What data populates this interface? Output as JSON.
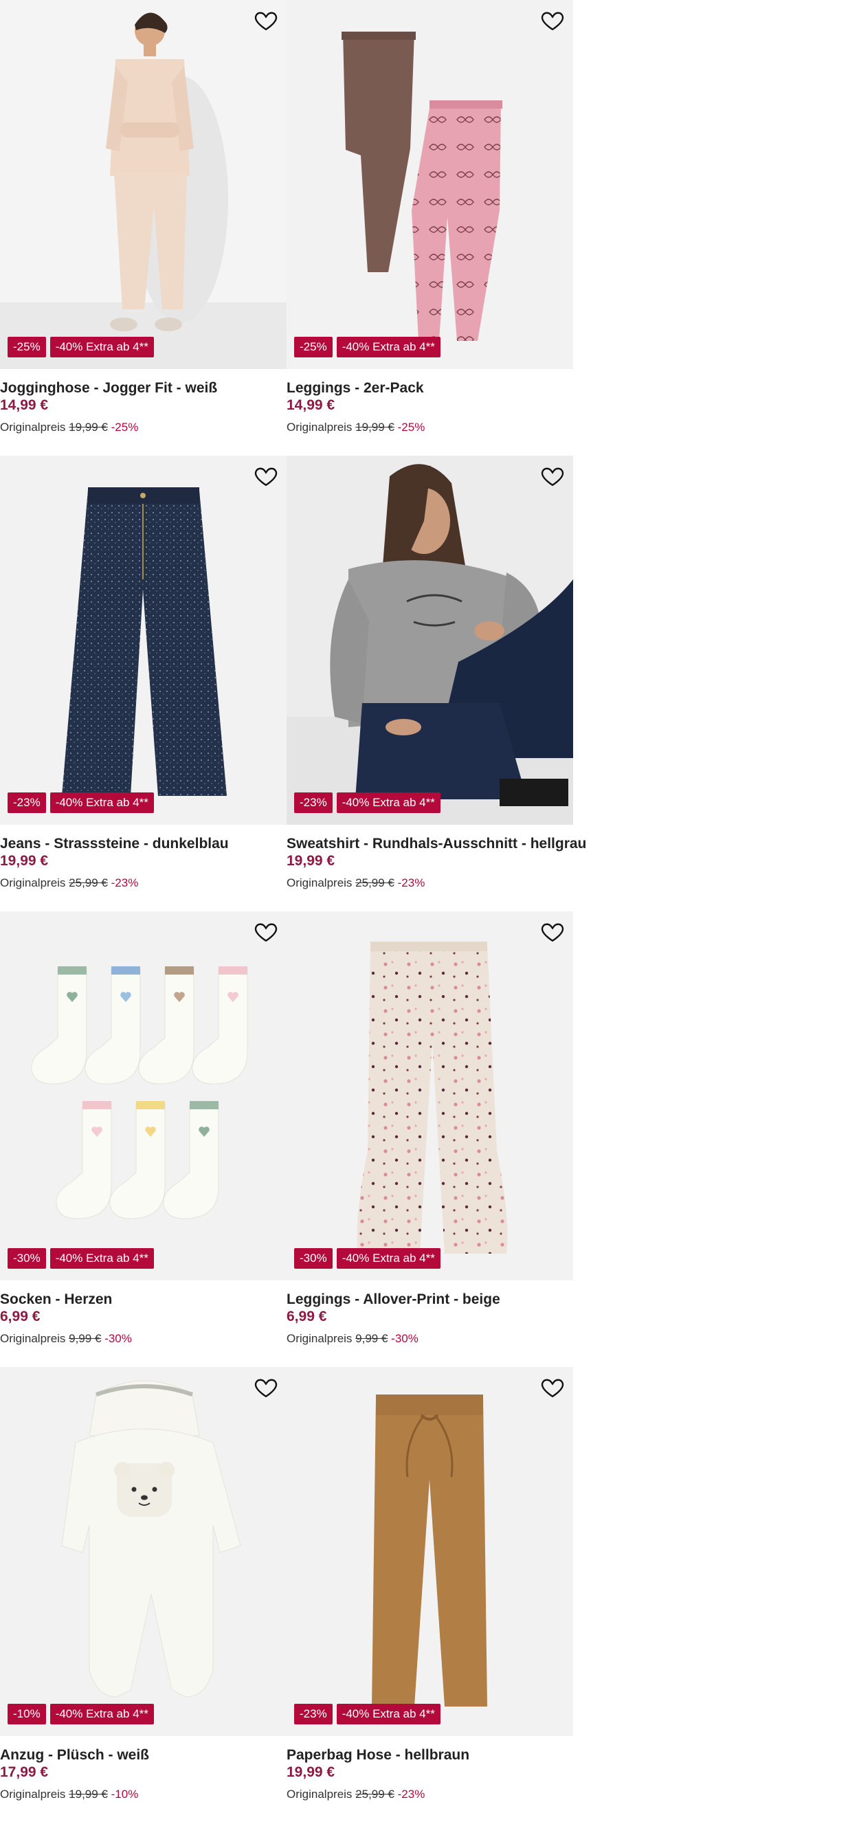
{
  "products": [
    {
      "title": "Jogginghose - Jogger Fit - weiß",
      "price": "14,99 €",
      "discount": "-25%",
      "extra": "-40% Extra ab 4**",
      "orig_label": "Originalpreis",
      "orig_price": "19,99 €",
      "orig_pct": "-25%"
    },
    {
      "title": "Leggings - 2er-Pack",
      "price": "14,99 €",
      "discount": "-25%",
      "extra": "-40% Extra ab 4**",
      "orig_label": "Originalpreis",
      "orig_price": "19,99 €",
      "orig_pct": "-25%"
    },
    {
      "title": "Jeans - Strasssteine - dunkelblau",
      "price": "19,99 €",
      "discount": "-23%",
      "extra": "-40% Extra ab 4**",
      "orig_label": "Originalpreis",
      "orig_price": "25,99 €",
      "orig_pct": "-23%"
    },
    {
      "title": "Sweatshirt - Rundhals-Ausschnitt - hellgrau",
      "price": "19,99 €",
      "discount": "-23%",
      "extra": "-40% Extra ab 4**",
      "orig_label": "Originalpreis",
      "orig_price": "25,99 €",
      "orig_pct": "-23%"
    },
    {
      "title": "Socken - Herzen",
      "price": "6,99 €",
      "discount": "-30%",
      "extra": "-40% Extra ab 4**",
      "orig_label": "Originalpreis",
      "orig_price": "9,99 €",
      "orig_pct": "-30%"
    },
    {
      "title": "Leggings - Allover-Print - beige",
      "price": "6,99 €",
      "discount": "-30%",
      "extra": "-40% Extra ab 4**",
      "orig_label": "Originalpreis",
      "orig_price": "9,99 €",
      "orig_pct": "-30%"
    },
    {
      "title": "Anzug - Plüsch - weiß",
      "price": "17,99 €",
      "discount": "-10%",
      "extra": "-40% Extra ab 4**",
      "orig_label": "Originalpreis",
      "orig_price": "19,99 €",
      "orig_pct": "-10%"
    },
    {
      "title": "Paperbag Hose - hellbraun",
      "price": "19,99 €",
      "discount": "-23%",
      "extra": "-40% Extra ab 4**",
      "orig_label": "Originalpreis",
      "orig_price": "25,99 €",
      "orig_pct": "-23%"
    }
  ],
  "icons": {
    "wishlist": "heart-outline-icon"
  },
  "colors": {
    "badge": "#b3093b",
    "price": "#8d1a3f",
    "image_bg": "#f2f2f2"
  }
}
